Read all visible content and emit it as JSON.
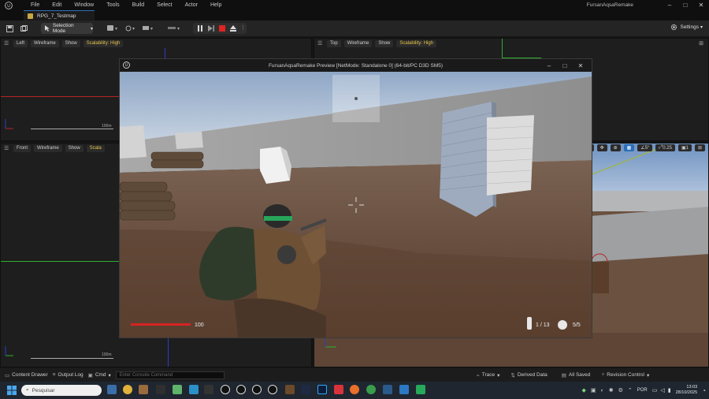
{
  "window": {
    "project_name": "FursanAqsaRemake",
    "controls": [
      "–",
      "□",
      "✕"
    ]
  },
  "menu": [
    "File",
    "Edit",
    "Window",
    "Tools",
    "Build",
    "Select",
    "Actor",
    "Help"
  ],
  "level_tab": "RPG_7_Testmap",
  "toolbar": {
    "mode": "Selection Mode",
    "settings": "Settings"
  },
  "viewports": {
    "left": {
      "name": "Left",
      "view_mode": "Wireframe",
      "show": "Show",
      "scalability": "Scalability: High",
      "scale": "100m"
    },
    "top": {
      "name": "Top",
      "view_mode": "Wireframe",
      "show": "Show",
      "scalability": "Scalability: High"
    },
    "front": {
      "name": "Front",
      "view_mode": "Wireframe",
      "show": "Show",
      "scalability": "Scala",
      "scale": "100m"
    },
    "persp": {
      "rot_snap": "5°",
      "scale_snap": "0.25",
      "cam_speed": "1"
    }
  },
  "preview": {
    "title": "FursanAqsaRemake Preview [NetMode: Standalone 0]  (64-bit/PC D3D SM5)",
    "health_value": "100",
    "health_fraction": 1.0,
    "ammo": "1 / 13",
    "grenades": "5/5"
  },
  "statusbar": {
    "content_drawer": "Content Drawer",
    "output_log": "Output Log",
    "cmd": "Cmd",
    "console_placeholder": "Enter Console Command",
    "trace": "Trace",
    "derived_data": "Derived Data",
    "all_saved": "All Saved",
    "revision_control": "Revision Control"
  },
  "taskbar": {
    "search_placeholder": "Pesquisar",
    "language": "POR",
    "time": "13:03",
    "date": "28/10/2025"
  },
  "colors": {
    "accent": "#e6c24a",
    "health": "#d62222",
    "axis_x": "#b52525",
    "axis_y": "#2fae2f",
    "axis_z": "#2b3fc4"
  }
}
